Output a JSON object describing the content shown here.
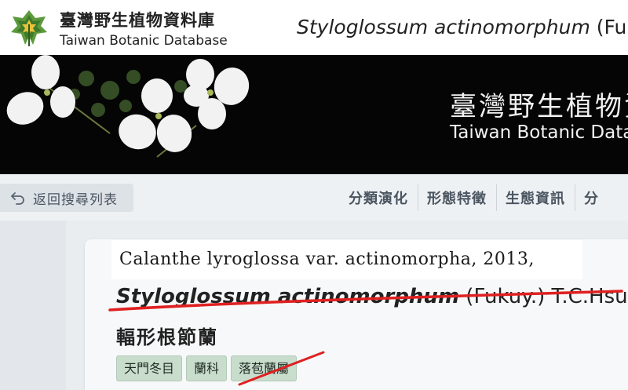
{
  "header": {
    "site_name_zh": "臺灣野生植物資料庫",
    "site_name_en": "Taiwan Botanic Database",
    "species_title_genus": "Styloglossum actinomorphum",
    "species_title_author": "(Fukuy"
  },
  "banner": {
    "title_zh": "臺灣野生植物資",
    "title_en": "Taiwan Botanic Datal"
  },
  "nav": {
    "back_label": "返回搜尋列表",
    "links": [
      "分類演化",
      "形態特徵",
      "生態資訊",
      "分"
    ]
  },
  "species": {
    "synonym": "Calanthe lyroglossa var. actinomorpha, 2013,",
    "scientific_genus": "Styloglossum actinomorphum",
    "scientific_author": " (Fukuy.) T.C.Hsu",
    "chinese_name": "輻形根節蘭",
    "tags": [
      "天門冬目",
      "蘭科",
      "落苞蘭屬"
    ]
  },
  "colors": {
    "tag_bg": "#c9ddcd",
    "strike_red": "#e02020",
    "banner_bg": "#050505"
  }
}
